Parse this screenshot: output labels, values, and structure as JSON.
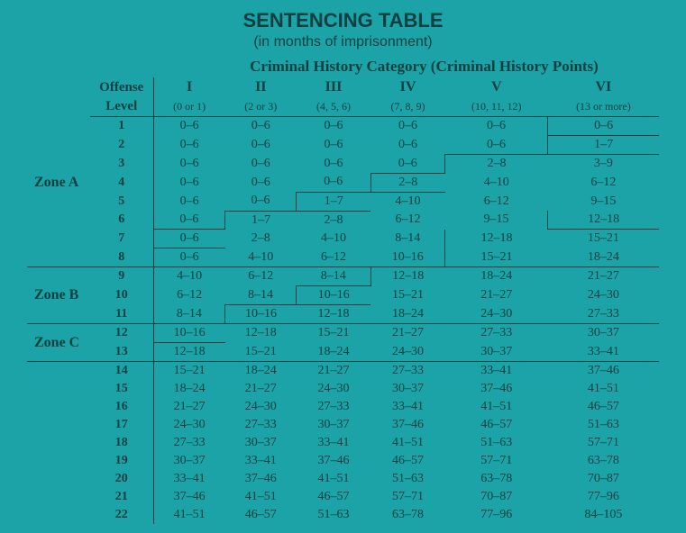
{
  "title": "SENTENCING TABLE",
  "subtitle": "(in months of imprisonment)",
  "super_header": "Criminal History Category  (Criminal History Points)",
  "offense_label": "Offense",
  "level_label": "Level",
  "columns": {
    "roman": [
      "I",
      "II",
      "III",
      "IV",
      "V",
      "VI"
    ],
    "points": [
      "(0 or 1)",
      "(2 or 3)",
      "(4, 5, 6)",
      "(7, 8, 9)",
      "(10, 11, 12)",
      "(13 or more)"
    ]
  },
  "zones": {
    "A": "Zone A",
    "B": "Zone B",
    "C": "Zone C"
  },
  "chart_data": {
    "type": "table",
    "title": "Sentencing Table (in months of imprisonment)",
    "xlabel": "Criminal History Category",
    "ylabel": "Offense Level",
    "categories": [
      "I",
      "II",
      "III",
      "IV",
      "V",
      "VI"
    ],
    "rows": [
      {
        "level": 1,
        "zone": "A",
        "values": [
          "0–6",
          "0–6",
          "0–6",
          "0–6",
          "0–6",
          "0–6"
        ]
      },
      {
        "level": 2,
        "zone": "A",
        "values": [
          "0–6",
          "0–6",
          "0–6",
          "0–6",
          "0–6",
          "1–7"
        ]
      },
      {
        "level": 3,
        "zone": "A",
        "values": [
          "0–6",
          "0–6",
          "0–6",
          "0–6",
          "2–8",
          "3–9"
        ]
      },
      {
        "level": 4,
        "zone": "A",
        "values": [
          "0–6",
          "0–6",
          "0–6",
          "2–8",
          "4–10",
          "6–12"
        ]
      },
      {
        "level": 5,
        "zone": "A",
        "values": [
          "0–6",
          "0–6",
          "1–7",
          "4–10",
          "6–12",
          "9–15"
        ]
      },
      {
        "level": 6,
        "zone": "A",
        "values": [
          "0–6",
          "1–7",
          "2–8",
          "6–12",
          "9–15",
          "12–18"
        ]
      },
      {
        "level": 7,
        "zone": "A",
        "values": [
          "0–6",
          "2–8",
          "4–10",
          "8–14",
          "12–18",
          "15–21"
        ]
      },
      {
        "level": 8,
        "zone": "A",
        "values": [
          "0–6",
          "4–10",
          "6–12",
          "10–16",
          "15–21",
          "18–24"
        ]
      },
      {
        "level": 9,
        "zone": "B",
        "values": [
          "4–10",
          "6–12",
          "8–14",
          "12–18",
          "18–24",
          "21–27"
        ]
      },
      {
        "level": 10,
        "zone": "B",
        "values": [
          "6–12",
          "8–14",
          "10–16",
          "15–21",
          "21–27",
          "24–30"
        ]
      },
      {
        "level": 11,
        "zone": "B",
        "values": [
          "8–14",
          "10–16",
          "12–18",
          "18–24",
          "24–30",
          "27–33"
        ]
      },
      {
        "level": 12,
        "zone": "C",
        "values": [
          "10–16",
          "12–18",
          "15–21",
          "21–27",
          "27–33",
          "30–37"
        ]
      },
      {
        "level": 13,
        "zone": "C",
        "values": [
          "12–18",
          "15–21",
          "18–24",
          "24–30",
          "30–37",
          "33–41"
        ]
      },
      {
        "level": 14,
        "zone": "",
        "values": [
          "15–21",
          "18–24",
          "21–27",
          "27–33",
          "33–41",
          "37–46"
        ]
      },
      {
        "level": 15,
        "zone": "",
        "values": [
          "18–24",
          "21–27",
          "24–30",
          "30–37",
          "37–46",
          "41–51"
        ]
      },
      {
        "level": 16,
        "zone": "",
        "values": [
          "21–27",
          "24–30",
          "27–33",
          "33–41",
          "41–51",
          "46–57"
        ]
      },
      {
        "level": 17,
        "zone": "",
        "values": [
          "24–30",
          "27–33",
          "30–37",
          "37–46",
          "46–57",
          "51–63"
        ]
      },
      {
        "level": 18,
        "zone": "",
        "values": [
          "27–33",
          "30–37",
          "33–41",
          "41–51",
          "51–63",
          "57–71"
        ]
      },
      {
        "level": 19,
        "zone": "",
        "values": [
          "30–37",
          "33–41",
          "37–46",
          "46–57",
          "57–71",
          "63–78"
        ]
      },
      {
        "level": 20,
        "zone": "",
        "values": [
          "33–41",
          "37–46",
          "41–51",
          "51–63",
          "63–78",
          "70–87"
        ]
      },
      {
        "level": 21,
        "zone": "",
        "values": [
          "37–46",
          "41–51",
          "46–57",
          "57–71",
          "70–87",
          "77–96"
        ]
      },
      {
        "level": 22,
        "zone": "",
        "values": [
          "41–51",
          "46–57",
          "51–63",
          "63–78",
          "77–96",
          "84–105"
        ]
      }
    ]
  }
}
